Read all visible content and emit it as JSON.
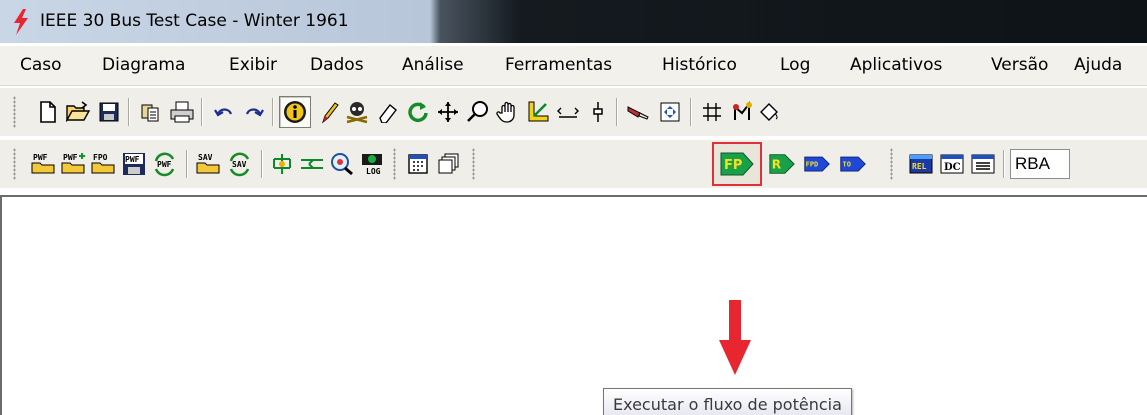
{
  "window": {
    "title": "IEEE 30 Bus Test Case - Winter 1961",
    "icon": "lightning-bolt-icon"
  },
  "menu": {
    "items": [
      "Caso",
      "Diagrama",
      "Exibir",
      "Dados",
      "Análise",
      "Ferramentas",
      "Histórico",
      "Log",
      "Aplicativos",
      "Versão",
      "Ajuda"
    ]
  },
  "toolbar2": {
    "labels": {
      "pwf_open": "PWF",
      "pwf_add": "PWF",
      "fpo_open": "FPO",
      "pwf_save": "PWF",
      "pwf_refresh": "PWF",
      "sav_open": "SAV",
      "sav_refresh": "SAV",
      "log": "LOG",
      "fp": "FP",
      "r": "R",
      "fpd": "FPD",
      "to": "TO",
      "rel": "REL",
      "dc": "DC"
    },
    "rba_text": "RBA"
  },
  "tooltip": {
    "text": "Executar o fluxo de potência"
  },
  "colors": {
    "annotation_red": "#e8262f",
    "fp_green": "#19a04a",
    "fpd_blue": "#1f47d8"
  }
}
